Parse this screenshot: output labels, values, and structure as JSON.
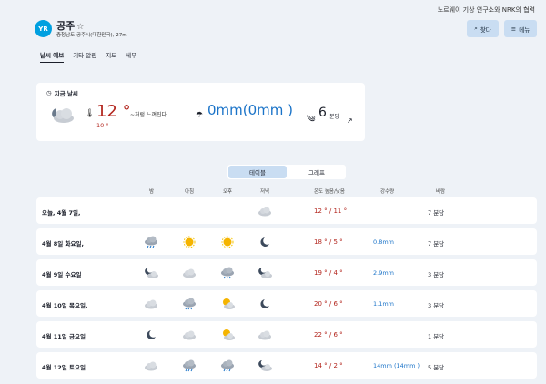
{
  "header": {
    "credit": "노르웨이 기상 연구소와 NRK의 협력",
    "logo": "YR",
    "place_name": "공주",
    "subtitle": "충청남도 공주시(대한민국), 27m",
    "search_label": "찾다",
    "menu_label": "메뉴"
  },
  "tabs": [
    "날씨 예보",
    "기타 알림",
    "지도",
    "세부"
  ],
  "now": {
    "title": "지금 날씨",
    "temp": "12 °",
    "feels": "~처럼 느껴진다",
    "feels_temp": "10 °",
    "precip": "0mm(0mm )",
    "wind": "6",
    "wind_unit": "분당"
  },
  "view_toggle": {
    "table": "테이블",
    "graph": "그래프"
  },
  "columns": [
    "밤",
    "아침",
    "오후",
    "저녁",
    "온도 높음/낮음",
    "강수량",
    "바람"
  ],
  "days": [
    {
      "date": "오늘, 4월 7일,",
      "icons": [
        "",
        "",
        "",
        "cloud"
      ],
      "temp_high": "12 °",
      "temp_low": "11 °",
      "precip": "",
      "wind": "7 분당"
    },
    {
      "date": "4월 8일 화요일,",
      "icons": [
        "rain-cloud",
        "sun",
        "sun",
        "moon"
      ],
      "temp_high": "18 °",
      "temp_low": "5 °",
      "precip": "0.8mm",
      "wind": "7 분당"
    },
    {
      "date": "4월 9일 수요일",
      "icons": [
        "moon-cloud",
        "cloud",
        "rain-cloud",
        "moon-cloud"
      ],
      "temp_high": "19 °",
      "temp_low": "4 °",
      "precip": "2.9mm",
      "wind": "3 분당"
    },
    {
      "date": "4월 10일 목요일,",
      "icons": [
        "cloud",
        "rain-cloud",
        "sun-cloud",
        "moon"
      ],
      "temp_high": "20 °",
      "temp_low": "6 °",
      "precip": "1.1mm",
      "wind": "3 분당"
    },
    {
      "date": "4월 11일 금요일",
      "icons": [
        "moon",
        "cloud",
        "sun-cloud",
        "cloud"
      ],
      "temp_high": "22 °",
      "temp_low": "6 °",
      "precip": "",
      "wind": "1 분당"
    },
    {
      "date": "4월 12일 토요일",
      "icons": [
        "cloud",
        "rain-cloud",
        "rain-cloud",
        "moon-cloud"
      ],
      "temp_high": "14 °",
      "temp_low": "2 °",
      "precip": "14mm (14mm )",
      "wind": "5 분당"
    }
  ]
}
